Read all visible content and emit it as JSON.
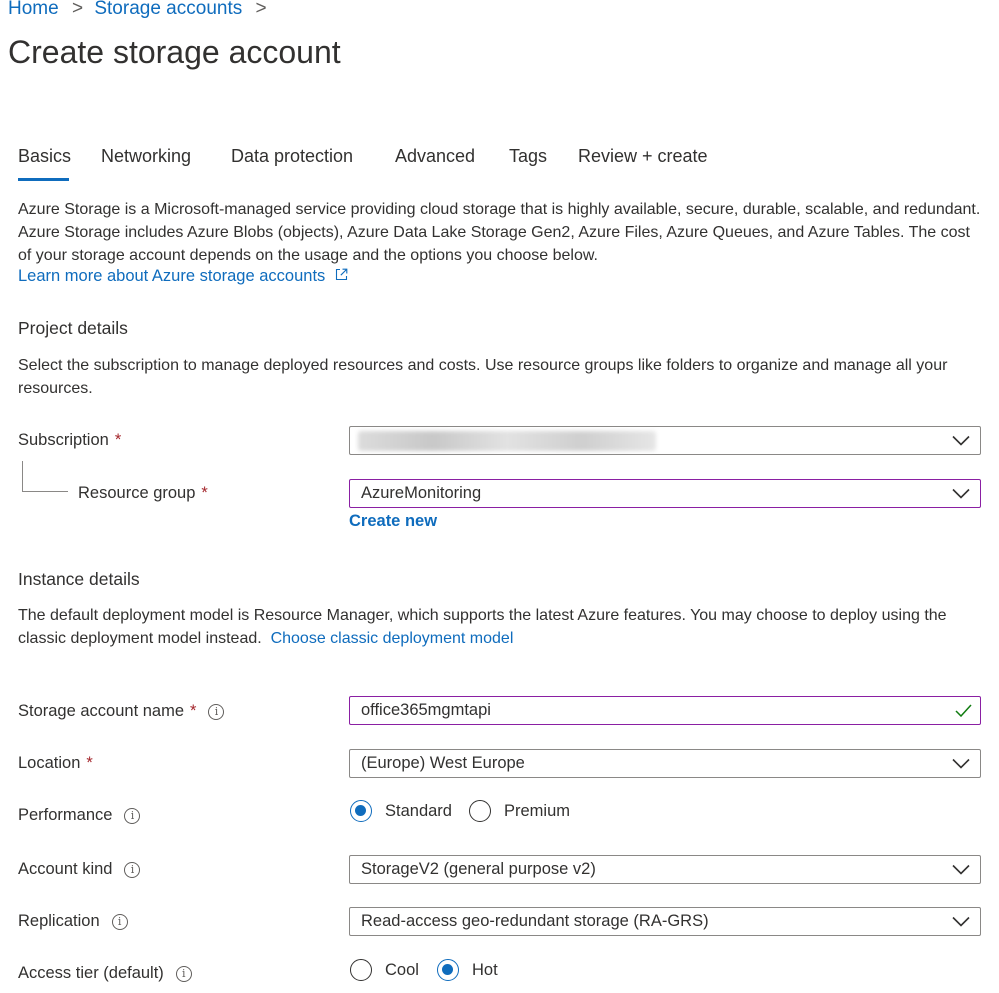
{
  "breadcrumb": {
    "home": "Home",
    "sep": ">",
    "storage_accounts": "Storage accounts"
  },
  "page_title": "Create storage account",
  "tabs": [
    {
      "label": "Basics",
      "active": true
    },
    {
      "label": "Networking"
    },
    {
      "label": "Data protection"
    },
    {
      "label": "Advanced"
    },
    {
      "label": "Tags"
    },
    {
      "label": "Review + create"
    }
  ],
  "intro": {
    "text": "Azure Storage is a Microsoft-managed service providing cloud storage that is highly available, secure, durable, scalable, and redundant. Azure Storage includes Azure Blobs (objects), Azure Data Lake Storage Gen2, Azure Files, Azure Queues, and Azure Tables. The cost of your storage account depends on the usage and the options you choose below.",
    "learn_more": "Learn more about Azure storage accounts",
    "external_icon": "external-link-icon"
  },
  "project": {
    "heading": "Project details",
    "desc": "Select the subscription to manage deployed resources and costs. Use resource groups like folders to organize and manage all your resources.",
    "subscription_label": "Subscription",
    "subscription_value": "",
    "resource_group_label": "Resource group",
    "resource_group_value": "AzureMonitoring",
    "create_new": "Create new"
  },
  "instance": {
    "heading": "Instance details",
    "desc": "The default deployment model is Resource Manager, which supports the latest Azure features. You may choose to deploy using the classic deployment model instead.",
    "classic_link": "Choose classic deployment model",
    "name_label": "Storage account name",
    "name_value": "office365mgmtapi",
    "location_label": "Location",
    "location_value": "(Europe) West Europe",
    "performance_label": "Performance",
    "performance_options": [
      "Standard",
      "Premium"
    ],
    "performance_selected": "Standard",
    "account_kind_label": "Account kind",
    "account_kind_value": "StorageV2 (general purpose v2)",
    "replication_label": "Replication",
    "replication_value": "Read-access geo-redundant storage (RA-GRS)",
    "access_tier_label": "Access tier (default)",
    "access_tier_options": [
      "Cool",
      "Hot"
    ],
    "access_tier_selected": "Hot"
  },
  "required_marker": "*",
  "info_glyph": "i",
  "colors": {
    "accent": "#0f6cbd",
    "required": "#a4262c",
    "focus_border": "#8a1fa3",
    "valid_check": "#107c10"
  }
}
